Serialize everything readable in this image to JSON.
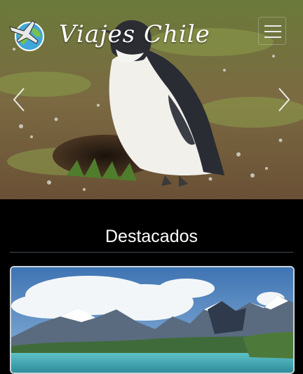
{
  "app": {
    "brand_name": "Viajes Chile"
  },
  "nav": {
    "menu_icon": "hamburger-icon"
  },
  "hero": {
    "prev_icon": "chevron-left-icon",
    "next_icon": "chevron-right-icon"
  },
  "featured": {
    "heading": "Destacados",
    "cards": [
      {
        "image": "torres-del-paine-landscape"
      }
    ]
  },
  "colors": {
    "background": "#000000",
    "divider": "#3d4a52",
    "text": "#ffffff"
  }
}
